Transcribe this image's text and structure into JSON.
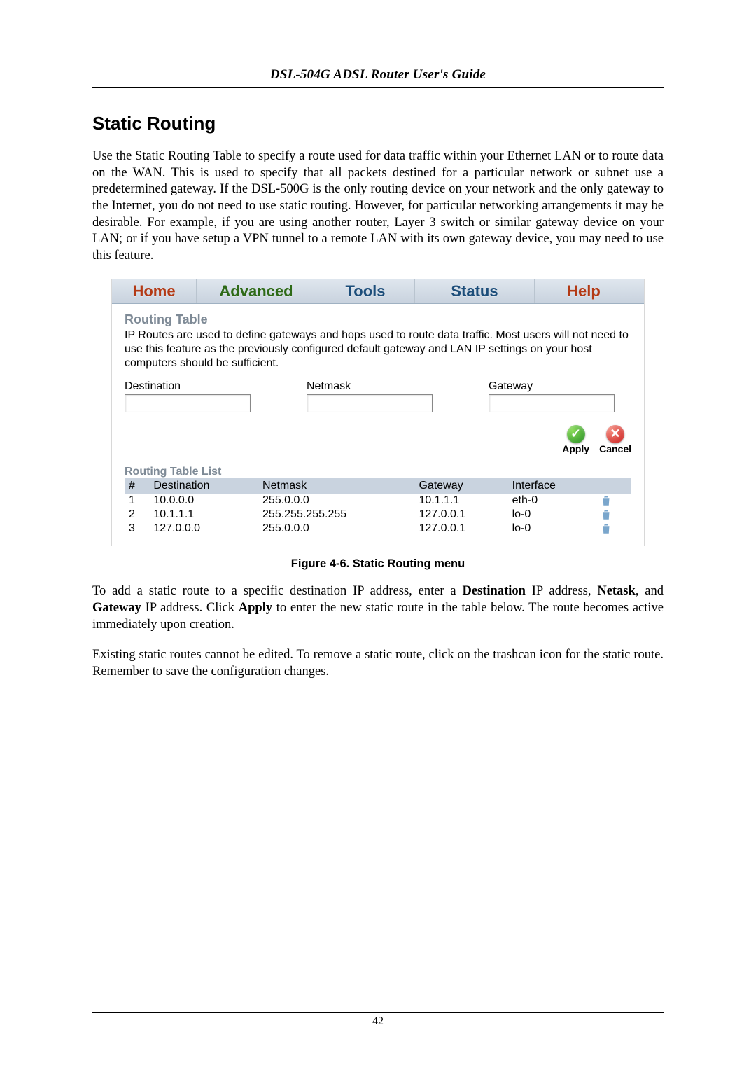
{
  "header": {
    "running_title": "DSL-504G ADSL Router User's Guide"
  },
  "section": {
    "title": "Static Routing"
  },
  "paragraphs": {
    "intro": "Use the Static Routing Table to specify a route used for data traffic within your Ethernet LAN or to route data on the WAN. This is used to specify that all packets destined for a particular network or subnet use a predetermined gateway. If the DSL-500G is the only routing device on your network and the only gateway to the Internet, you do not need to use static routing. However, for particular networking arrangements it may be desirable. For example, if you are using another router, Layer 3 switch or similar gateway device on your LAN; or if you have setup a VPN tunnel to a remote LAN with its own gateway device, you may need to use this feature.",
    "after1_pre": "To add a static route to a specific destination IP address, enter a ",
    "after1_b1": "Destination",
    "after1_mid1": " IP address, ",
    "after1_b2": "Netask",
    "after1_mid2": ", and ",
    "after1_b3": "Gateway",
    "after1_mid3": " IP address. Click ",
    "after1_b4": "Apply",
    "after1_post": " to enter the new static route in the table below. The route becomes active immediately upon creation.",
    "after2": "Existing static routes cannot be edited. To remove a static route, click on the trashcan icon for the static route. Remember to save the configuration changes."
  },
  "figure": {
    "caption": "Figure 4-6. Static Routing menu"
  },
  "page_number": "42",
  "ui": {
    "tabs": {
      "home": "Home",
      "advanced": "Advanced",
      "tools": "Tools",
      "status": "Status",
      "help": "Help"
    },
    "routing_table": {
      "title": "Routing Table",
      "desc": "IP Routes are used to define gateways and hops used to route data traffic. Most users will not need to use this feature as the previously configured default gateway and LAN IP settings on your host computers should be sufficient.",
      "fields": {
        "destination": "Destination",
        "netmask": "Netmask",
        "gateway": "Gateway"
      },
      "buttons": {
        "apply": "Apply",
        "cancel": "Cancel"
      }
    },
    "routing_list": {
      "title": "Routing Table List",
      "cols": {
        "num": "#",
        "dest": "Destination",
        "mask": "Netmask",
        "gw": "Gateway",
        "if": "Interface"
      },
      "rows": [
        {
          "num": "1",
          "dest": "10.0.0.0",
          "mask": "255.0.0.0",
          "gw": "10.1.1.1",
          "if": "eth-0"
        },
        {
          "num": "2",
          "dest": "10.1.1.1",
          "mask": "255.255.255.255",
          "gw": "127.0.0.1",
          "if": "lo-0"
        },
        {
          "num": "3",
          "dest": "127.0.0.0",
          "mask": "255.0.0.0",
          "gw": "127.0.0.1",
          "if": "lo-0"
        }
      ]
    }
  }
}
